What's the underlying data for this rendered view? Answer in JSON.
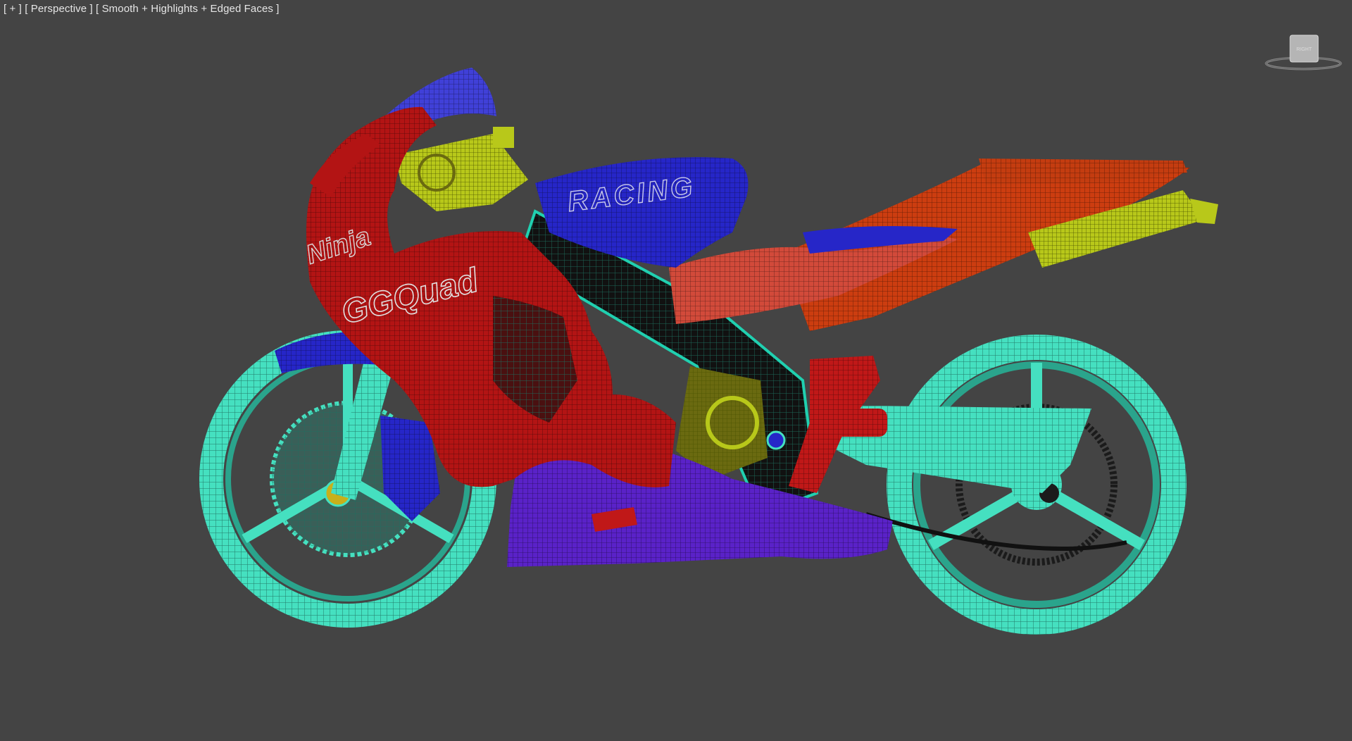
{
  "viewport": {
    "menu_label": "[ + ]",
    "view_label": "[ Perspective ]",
    "shading_label": "[ Smooth + Highlights + Edged Faces ]",
    "background": "#444444"
  },
  "viewcube": {
    "face_label": "RIGHT"
  },
  "model": {
    "decals": {
      "tank": "RACING",
      "fairing_logo": "Ninja",
      "fairing_main": "GGQuad"
    },
    "colors": {
      "wheels": "#45e0c0",
      "fairing": "#b31414",
      "tail": "#cc3d10",
      "tank": "#2626c8",
      "belly_pan": "#5a22c8",
      "exhaust": "#b8c81a",
      "frame": "#20d0b0"
    }
  }
}
